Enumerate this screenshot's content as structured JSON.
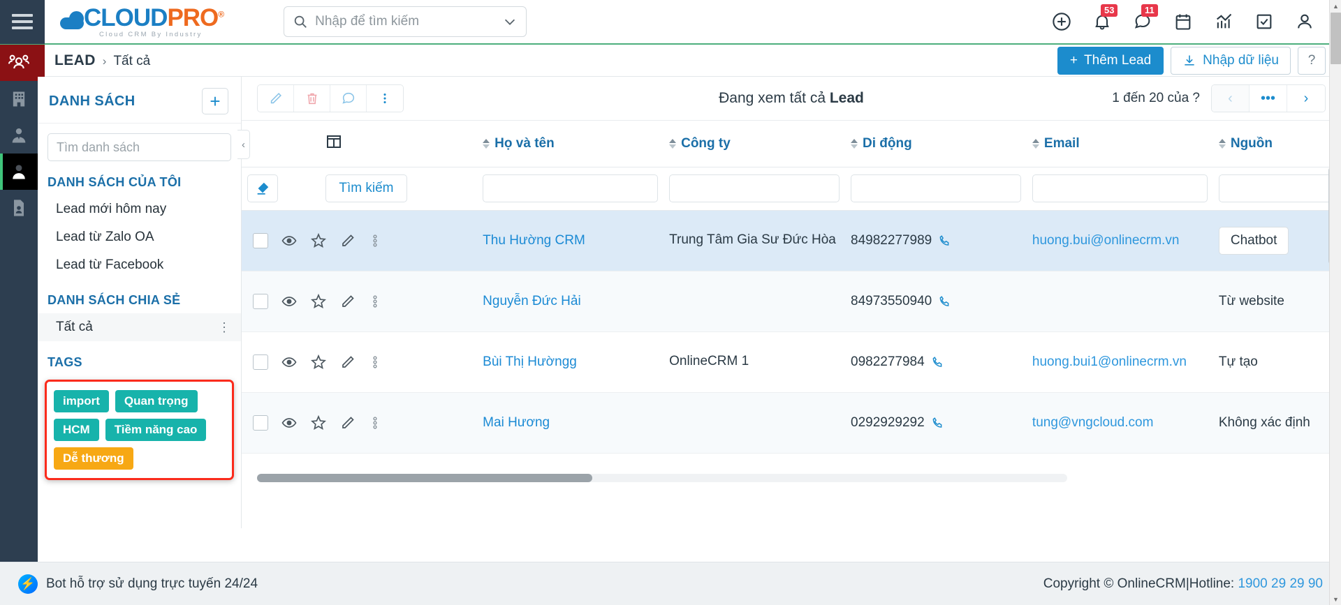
{
  "header": {
    "logo": {
      "main_1": "CLOUD",
      "main_2": "PRO",
      "registered": "®",
      "tagline": "Cloud CRM By Industry"
    },
    "search": {
      "placeholder": "Nhập để tìm kiếm",
      "value": ""
    },
    "icons": [
      {
        "name": "add-icon",
        "badge": null
      },
      {
        "name": "bell-icon",
        "badge": "53"
      },
      {
        "name": "chat-icon",
        "badge": "11"
      },
      {
        "name": "calendar-icon",
        "badge": null
      },
      {
        "name": "analytics-icon",
        "badge": null
      },
      {
        "name": "task-icon",
        "badge": null
      },
      {
        "name": "user-icon",
        "badge": null
      }
    ]
  },
  "breadcrumb": {
    "root": "LEAD",
    "separator": "›",
    "current": "Tất cả"
  },
  "actions": {
    "add_lead": "Thêm Lead",
    "add_lead_icon": "+",
    "import_data": "Nhập dữ liệu",
    "help": "?"
  },
  "rail": {
    "items": [
      {
        "name": "contacts-group-icon",
        "state": "red"
      },
      {
        "name": "company-building-icon",
        "state": "normal"
      },
      {
        "name": "person-tie-icon",
        "state": "normal"
      },
      {
        "name": "lead-person-icon",
        "state": "selected"
      },
      {
        "name": "document-person-icon",
        "state": "normal"
      }
    ]
  },
  "list_panel": {
    "title": "DANH SÁCH",
    "add_button": "+",
    "search_placeholder": "Tìm danh sách",
    "search_value": "",
    "my_lists_header": "DANH SÁCH CỦA TÔI",
    "my_lists": [
      "Lead mới hôm nay",
      "Lead từ Zalo OA",
      "Lead từ Facebook"
    ],
    "shared_header": "DANH SÁCH CHIA SẺ",
    "shared_lists": [
      "Tất cả"
    ],
    "tags_header": "TAGS",
    "tags": [
      {
        "label": "import",
        "color": "#17b3ab"
      },
      {
        "label": "Quan trọng",
        "color": "#17b3ab"
      },
      {
        "label": "HCM",
        "color": "#17b3ab"
      },
      {
        "label": "Tiềm năng cao",
        "color": "#17b3ab"
      },
      {
        "label": "Dễ thương",
        "color": "#f7a814"
      }
    ],
    "highlight_color": "#fb2b1c"
  },
  "toolbar": {
    "buttons": [
      {
        "name": "edit-pencil-icon",
        "label": ""
      },
      {
        "name": "delete-trash-icon",
        "label": ""
      },
      {
        "name": "comment-icon",
        "label": ""
      },
      {
        "name": "more-options-icon",
        "label": ""
      }
    ],
    "view_title_prefix": "Đang xem tất cả ",
    "view_title_bold": "Lead",
    "pagination_text": "1 đến 20 của  ?",
    "prev": "‹",
    "more": "•••",
    "next": "›"
  },
  "table": {
    "columns": [
      {
        "key": "select",
        "label": ""
      },
      {
        "key": "columns_icon",
        "label": ""
      },
      {
        "key": "name",
        "label": "Họ và tên",
        "sortable": true
      },
      {
        "key": "company",
        "label": "Công ty",
        "sortable": true
      },
      {
        "key": "mobile",
        "label": "Di động",
        "sortable": true
      },
      {
        "key": "email",
        "label": "Email",
        "sortable": true
      },
      {
        "key": "source",
        "label": "Nguồn",
        "sortable": true
      }
    ],
    "filter_row": {
      "clear_button_icon": "eraser-icon",
      "search_button": "Tìm kiếm",
      "name_value": "",
      "company_value": "",
      "mobile_value": "",
      "email_value": "",
      "source_value": ""
    },
    "rows": [
      {
        "selected": true,
        "name": "Thu Hường CRM",
        "company": "Trung Tâm Gia Sư Đức Hòa",
        "mobile": "84982277989",
        "email": "huong.bui@onlinecrm.vn",
        "source": "Chatbot",
        "source_is_chip": true
      },
      {
        "selected": false,
        "name": "Nguyễn Đức Hải",
        "company": "",
        "mobile": "84973550940",
        "email": "",
        "source": "Từ website",
        "source_is_chip": false
      },
      {
        "selected": false,
        "name": "Bùi Thị Hườngg",
        "company": "OnlineCRM 1",
        "mobile": "0982277984",
        "email": "huong.bui1@onlinecrm.vn",
        "source": "Tự tạo",
        "source_is_chip": false
      },
      {
        "selected": false,
        "name": "Mai Hương",
        "company": "",
        "mobile": "0292929292",
        "email": "tung@vngcloud.com",
        "source": "Không xác định",
        "source_is_chip": false
      }
    ]
  },
  "footer": {
    "bot_text": "Bot hỗ trợ sử dụng trực tuyến 24/24",
    "copyright": "Copyright © OnlineCRM",
    "divider": "|",
    "hotline_label": "Hotline:",
    "hotline_number": "1900 29 29 90"
  }
}
